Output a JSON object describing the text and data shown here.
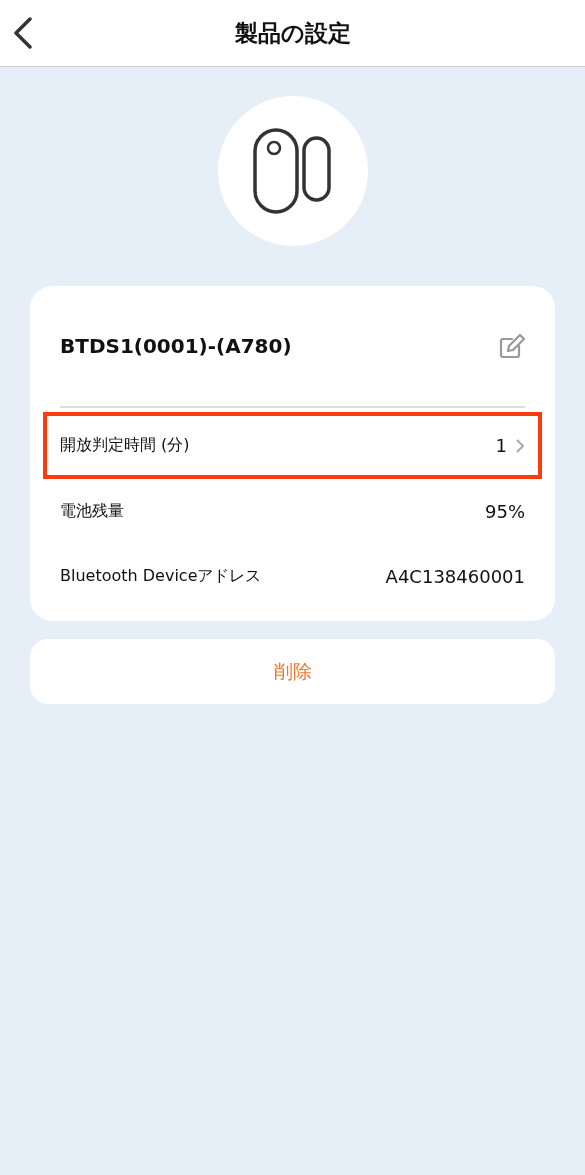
{
  "header": {
    "title": "製品の設定"
  },
  "device": {
    "name": "BTDS1(0001)-(A780)"
  },
  "rows": [
    {
      "kind": "link",
      "label": "開放判定時間 (分)",
      "value": "1",
      "highlighted": true
    },
    {
      "kind": "info",
      "label": "電池残量",
      "value": "95%",
      "highlighted": false
    },
    {
      "kind": "info",
      "label": "Bluetooth Deviceアドレス",
      "value": "A4C138460001",
      "highlighted": false
    }
  ],
  "delete_button": {
    "label": "削除"
  }
}
